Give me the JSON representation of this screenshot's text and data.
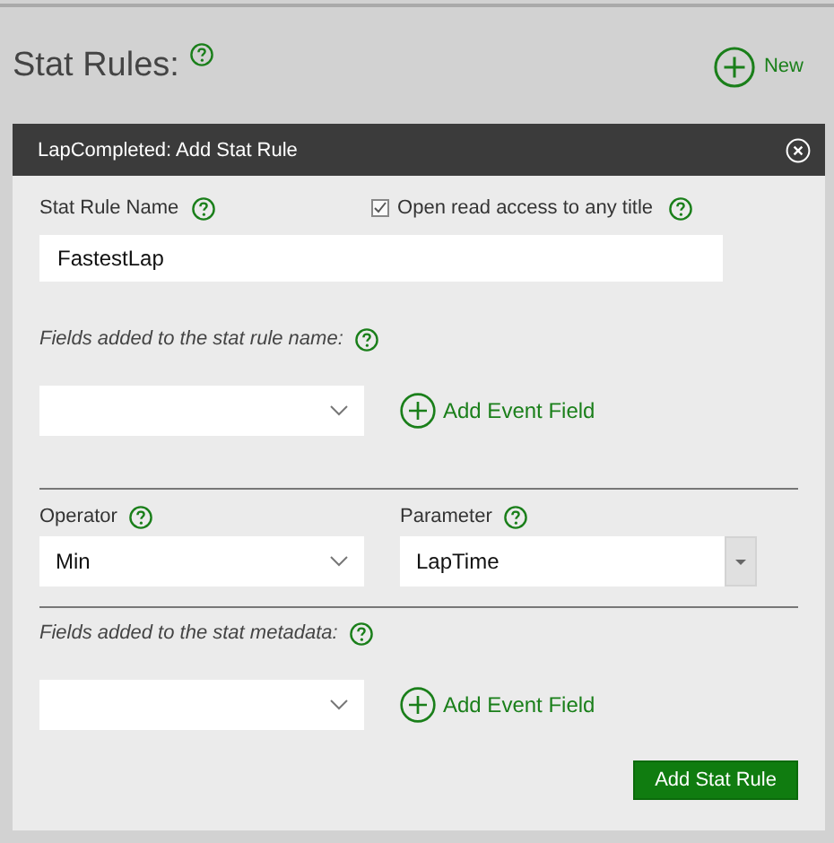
{
  "page": {
    "title": "Stat Rules:",
    "new_button": "New"
  },
  "dialog": {
    "title": "LapCompleted: Add Stat Rule",
    "name_label": "Stat Rule Name",
    "name_value": "FastestLap",
    "open_access": {
      "label": "Open read access to any title",
      "checked": true
    },
    "name_fields": {
      "label": "Fields added to the stat rule name:",
      "add_button": "Add Event Field"
    },
    "operator": {
      "label": "Operator",
      "value": "Min"
    },
    "parameter": {
      "label": "Parameter",
      "value": "LapTime"
    },
    "metadata_fields": {
      "label": "Fields added to the stat metadata:",
      "add_button": "Add Event Field"
    },
    "submit": "Add Stat Rule"
  }
}
